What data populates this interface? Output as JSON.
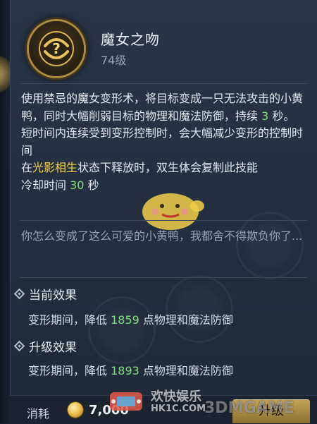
{
  "skill": {
    "name": "魔女之吻",
    "level": "74级",
    "icon": "question-swirl-icon"
  },
  "description": {
    "part1": "使用禁忌的魔女变形术，将目标变成一只无法攻击的小黄鸭，同时大幅削弱目标的物理和魔法防御，持续 ",
    "duration": "3",
    "part2": " 秒。短时间内连续受到变形控制时，会大幅减少变形的控制时间",
    "part3": "在",
    "keyword": "光影相生",
    "part4": "状态下释放时，双生体会复制此技能"
  },
  "cooldown": {
    "label": "冷却时间 ",
    "value": "30",
    "unit": " 秒"
  },
  "flavor": "你怎么变成了这么可爱的小黄鸭，我都舍不得欺负你了...",
  "current_effect": {
    "title": "当前效果",
    "prefix": "变形期间，降低 ",
    "value": "1859",
    "suffix": " 点物理和魔法防御"
  },
  "upgrade_effect": {
    "title": "升级效果",
    "prefix": "变形期间，降低 ",
    "value": "1893",
    "suffix": " 点物理和魔法防御"
  },
  "footer": {
    "cost_label": "消耗",
    "cost_value": "7,000",
    "upgrade_label": "升级"
  },
  "watermark": {
    "text1": "欢快娱乐",
    "text2": "HK1C.COM",
    "text3": "3DMGAME"
  },
  "colors": {
    "accent_green": "#7fe07a",
    "accent_yellow": "#f2d34a",
    "gold": "#c4a55a"
  }
}
